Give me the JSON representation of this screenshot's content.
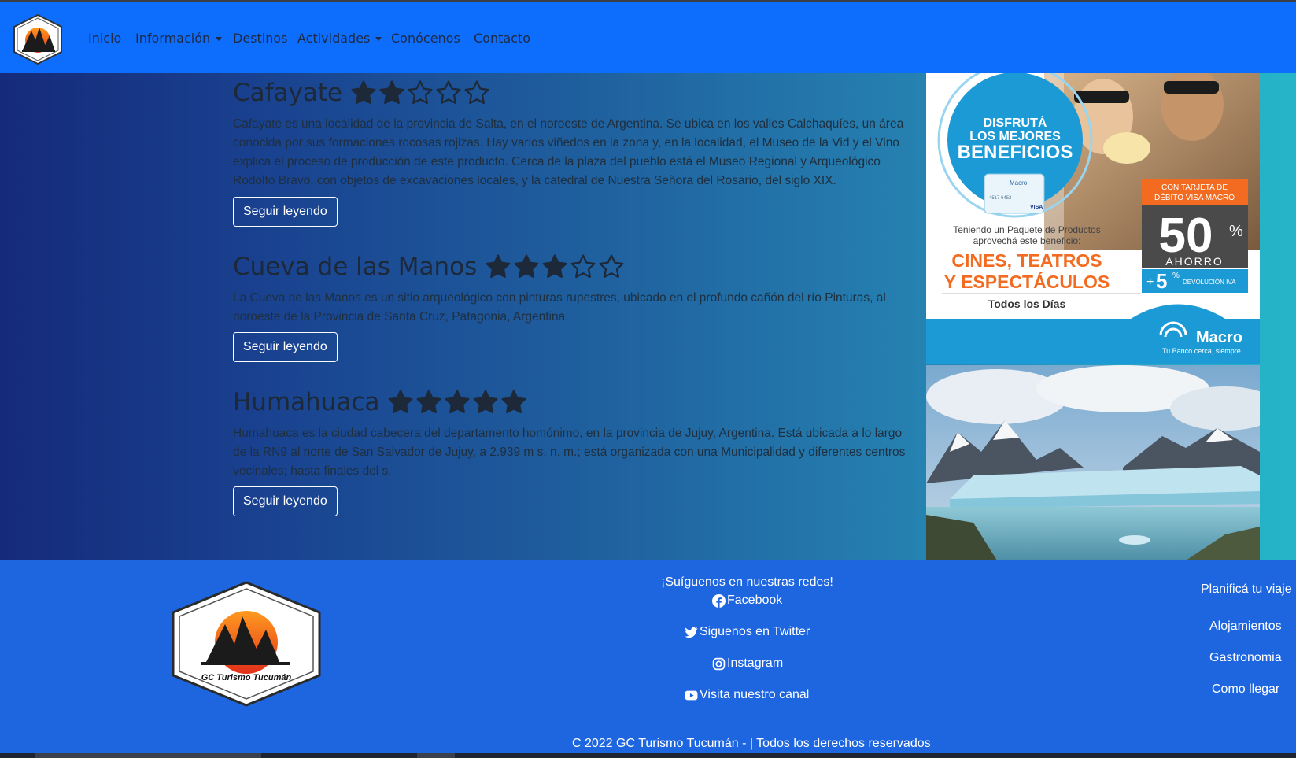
{
  "nav": {
    "items": [
      {
        "label": "Inicio"
      },
      {
        "label": "Información"
      },
      {
        "label": "Destinos"
      },
      {
        "label": "Actividades"
      },
      {
        "label": "Conócenos"
      },
      {
        "label": "Contacto"
      }
    ]
  },
  "logo": {
    "text": "GC Turismo Tucumán"
  },
  "articles": [
    {
      "title": "Cafayate",
      "rating": 2,
      "text": "Cafayate es una localidad de la provincia de Salta, en el noroeste de Argentina. Se ubica en los valles Calchaquíes, un área conocida por sus formaciones rocosas rojizas. Hay varios viñedos en la zona y, en la localidad, el Museo de la Vid y el Vino explica el proceso de producción de este producto. Cerca de la plaza del pueblo está el Museo Regional y Arqueológico Rodolfo Bravo, con objetos de excavaciones locales, y la catedral de Nuestra Señora del Rosario, del siglo XIX.",
      "button": "Seguir leyendo"
    },
    {
      "title": "Cueva de las Manos",
      "rating": 3,
      "text": "La Cueva de las Manos es un sitio arqueológico con pinturas rupestres, ubicado en el profundo cañón del río Pinturas, al noroeste de la Provincia de Santa Cruz, Patagonia, Argentina.",
      "button": "Seguir leyendo"
    },
    {
      "title": "Humahuaca",
      "rating": 5,
      "text": "Humahuaca es la ciudad cabecera del departamento homónimo, en la provincia de Jujuy, Argentina. Está ubicada a lo largo de la RN9 al norte de San Salvador de Jujuy, a 2.939 m s. n. m.; está organizada con una Municipalidad y diferentes centros vecinales; hasta finales del s.",
      "button": "Seguir leyendo"
    }
  ],
  "ad": {
    "headline1": "DISFRUTÁ",
    "headline2": "LOS MEJORES",
    "headline3": "BENEFICIOS",
    "card_brand": "Macro",
    "card_number": "4517 6452",
    "card_visa": "VISA",
    "package_line1": "Teniendo un Paquete de Productos",
    "package_line2": "aprovechá este beneficio:",
    "offer1": "CINES, TEATROS",
    "offer2": "Y ESPECTÁCULOS",
    "days": "Todos los Días",
    "tag1": "CON TARJETA DE",
    "tag2": "DÉBITO VISA MACRO",
    "discount": "50",
    "percent": "%",
    "savings": "AHORRO",
    "plus": "+",
    "refund_num": "5",
    "refund_text": "DEVOLUCIÓN IVA",
    "bank": "Macro",
    "bank_slogan": "Tu Banco cerca, siempre"
  },
  "footer": {
    "social_title": "¡Suíguenos en nuestras redes!",
    "social": [
      {
        "label": "Facebook",
        "icon": "facebook-icon"
      },
      {
        "label": "Siguenos en Twitter",
        "icon": "twitter-icon"
      },
      {
        "label": "Instagram",
        "icon": "instagram-icon"
      },
      {
        "label": "Visita nuestro canal",
        "icon": "youtube-icon"
      }
    ],
    "plan_title": "Planificá tu viaje",
    "plan_links": [
      "Alojamientos",
      "Gastronomia",
      "Como llegar"
    ],
    "copyright": "C 2022 GC Turismo Tucumán - | Todos los derechos reservados"
  },
  "colors": {
    "navbar": "#0d6efd",
    "footer": "#1e66e0",
    "ad_blue": "#1b9ad6",
    "ad_orange": "#f26b21"
  }
}
